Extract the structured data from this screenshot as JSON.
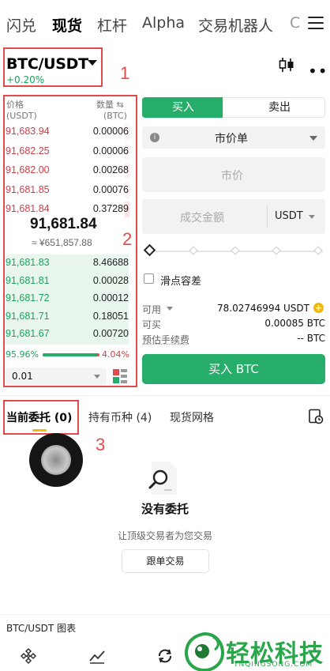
{
  "top_tabs": [
    "闪兑",
    "现货",
    "杠杆",
    "Alpha",
    "交易机器人",
    "C"
  ],
  "active_top_tab": "现货",
  "pair": {
    "name": "BTC/USDT",
    "change": "+0.20%"
  },
  "annotations": [
    "1",
    "2",
    "3"
  ],
  "order_book": {
    "price_header": "价格",
    "price_unit": "(USDT)",
    "qty_header": "数量 ⇆",
    "qty_unit": "(BTC)",
    "asks": [
      {
        "price": "91,683.94",
        "qty": "0.00006",
        "depth": 0.05
      },
      {
        "price": "91,682.25",
        "qty": "0.00006",
        "depth": 0.05
      },
      {
        "price": "91,682.00",
        "qty": "0.00268",
        "depth": 0.1
      },
      {
        "price": "91,681.85",
        "qty": "0.00076",
        "depth": 0.1
      },
      {
        "price": "91,681.84",
        "qty": "0.37289",
        "depth": 0.6
      }
    ],
    "last_price": "91,681.84",
    "last_price_cny": "≈ ¥651,857.88",
    "bids": [
      {
        "price": "91,681.83",
        "qty": "8.46688"
      },
      {
        "price": "91,681.81",
        "qty": "0.00028"
      },
      {
        "price": "91,681.72",
        "qty": "0.00012"
      },
      {
        "price": "91,681.71",
        "qty": "0.18051"
      },
      {
        "price": "91,681.67",
        "qty": "0.00720"
      }
    ],
    "buy_ratio": "95.96%",
    "sell_ratio": "4.04%",
    "buy_ratio_value": 0.9596,
    "depth_step": "0.01"
  },
  "form": {
    "buy_tab": "买入",
    "sell_tab": "卖出",
    "order_type": "市价单",
    "price_placeholder": "市价",
    "amount_placeholder": "成交金额",
    "amount_unit": "USDT",
    "slippage_label": "滑点容差",
    "available_label": "可用",
    "available_value": "78.02746994 USDT",
    "can_buy_label": "可买",
    "can_buy_value": "0.00085 BTC",
    "fee_label": "预估手续费",
    "fee_value": "-- BTC",
    "buy_button": "买入 BTC"
  },
  "sub_tabs": [
    "当前委托 (0)",
    "持有币种 (4)",
    "现货网格"
  ],
  "empty": {
    "title": "没有委托",
    "subtitle": "让顶级交易者为您交易",
    "button": "跟单交易"
  },
  "chart_bar_label": "BTC/USDT 图表",
  "watermark": {
    "text": "轻松科技",
    "url": "YNQINGSONG.COM"
  },
  "colors": {
    "buy": "#27ad6a",
    "sell": "#e24b4b",
    "highlight": "#f0b90b"
  }
}
